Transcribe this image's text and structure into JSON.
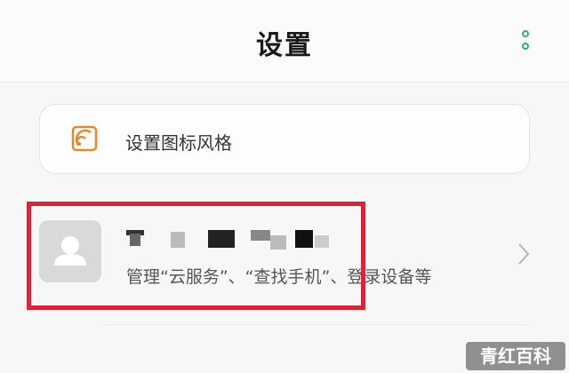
{
  "header": {
    "title": "设置",
    "more_icon": "more-vertical-icon",
    "accent": "#2fb36b"
  },
  "icon_style": {
    "label": "设置图标风格",
    "icon": "picture-style-icon",
    "icon_color": "#e08a2c"
  },
  "account": {
    "avatar_icon": "person-icon",
    "subtitle": "管理“云服务”、“查找手机”、登录设备等",
    "chevron": "chevron-right-icon"
  },
  "annotation": {
    "color": "#d3283a"
  },
  "watermark": {
    "text": "青红百科"
  }
}
